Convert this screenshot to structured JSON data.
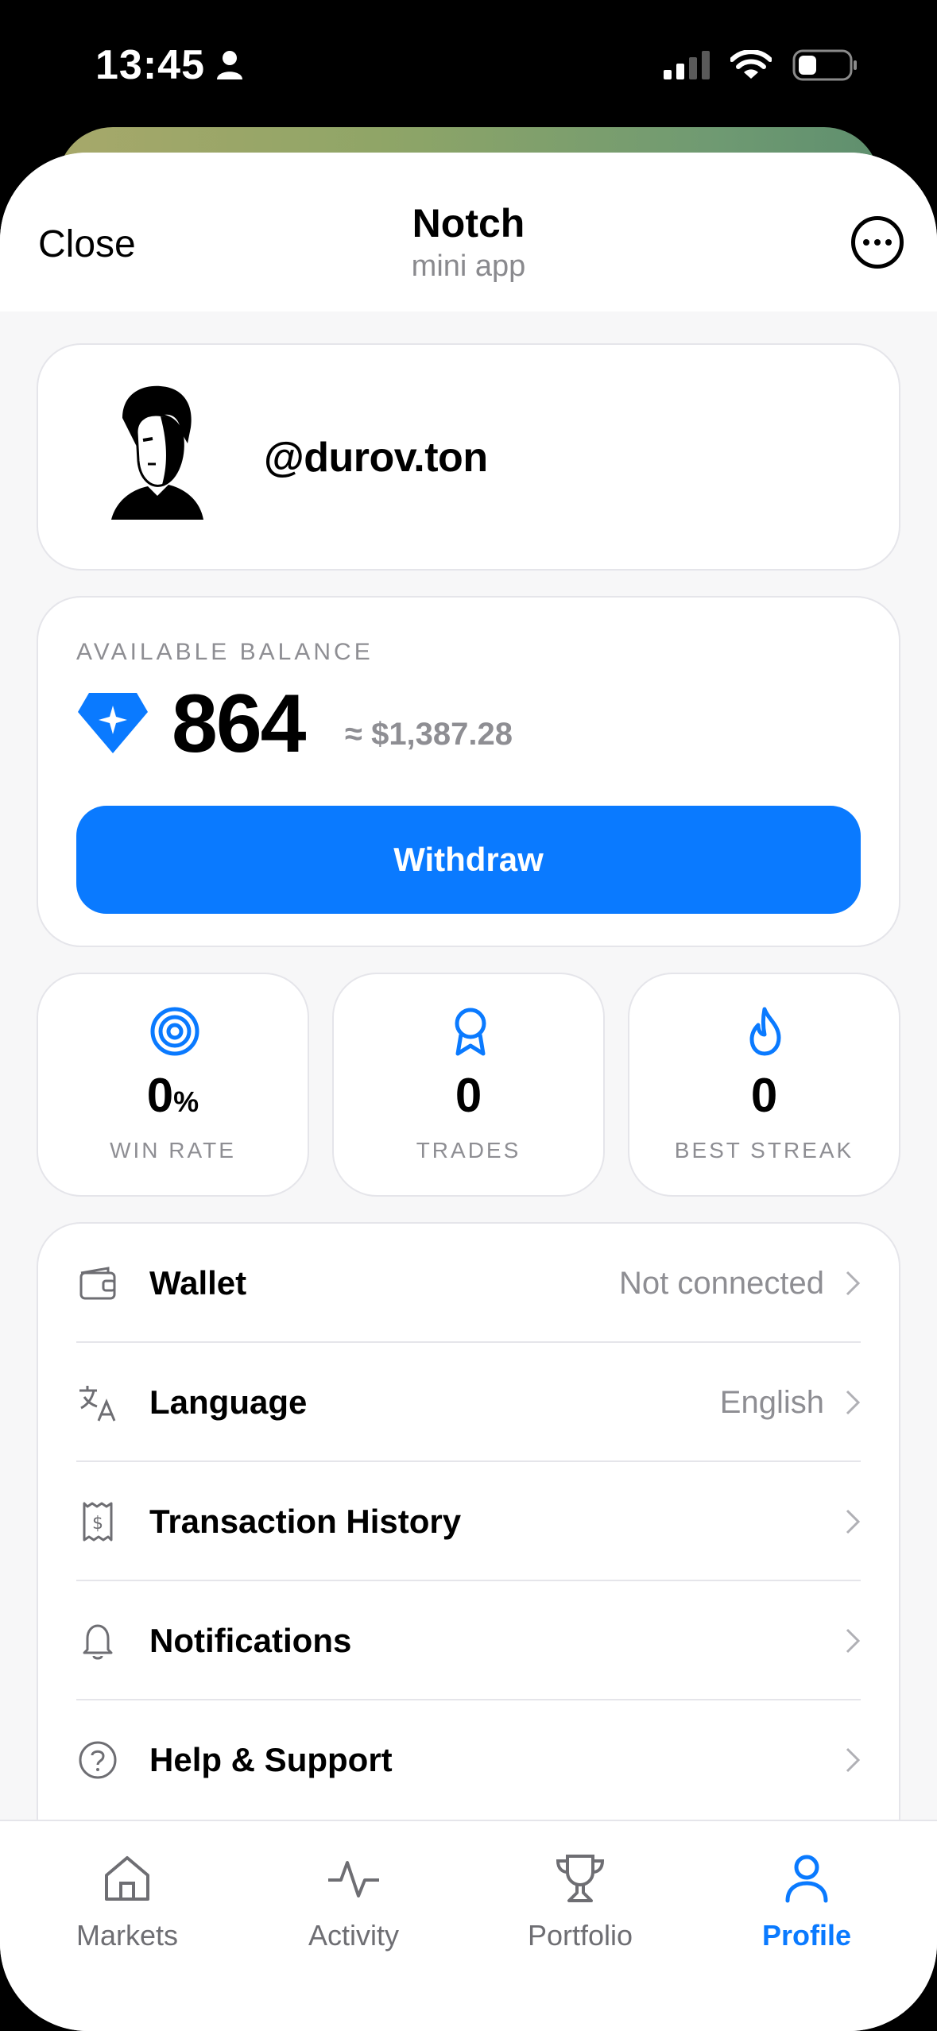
{
  "status_bar": {
    "time": "13:45"
  },
  "header": {
    "close_label": "Close",
    "title": "Notch",
    "subtitle": "mini app"
  },
  "profile": {
    "username": "@durov.ton"
  },
  "balance": {
    "label": "AVAILABLE BALANCE",
    "value": "864",
    "usd": "≈ $1,387.28",
    "withdraw_label": "Withdraw"
  },
  "stats": [
    {
      "value": "0",
      "unit": "%",
      "label": "WIN RATE",
      "icon": "target-icon"
    },
    {
      "value": "0",
      "unit": "",
      "label": "TRADES",
      "icon": "award-ribbon-icon"
    },
    {
      "value": "0",
      "unit": "",
      "label": "BEST STREAK",
      "icon": "flame-icon"
    }
  ],
  "menu": [
    {
      "label": "Wallet",
      "value": "Not connected",
      "icon": "wallet-icon"
    },
    {
      "label": "Language",
      "value": "English",
      "icon": "translate-icon"
    },
    {
      "label": "Transaction History",
      "value": "",
      "icon": "receipt-icon"
    },
    {
      "label": "Notifications",
      "value": "",
      "icon": "bell-icon"
    },
    {
      "label": "Help & Support",
      "value": "",
      "icon": "help-icon"
    }
  ],
  "tabs": [
    {
      "label": "Markets",
      "icon": "home-icon",
      "active": false
    },
    {
      "label": "Activity",
      "icon": "activity-icon",
      "active": false
    },
    {
      "label": "Portfolio",
      "icon": "trophy-icon",
      "active": false
    },
    {
      "label": "Profile",
      "icon": "user-icon",
      "active": true
    }
  ],
  "colors": {
    "accent": "#0a7aff",
    "muted": "#8e8e93",
    "background": "#f7f7f8"
  }
}
